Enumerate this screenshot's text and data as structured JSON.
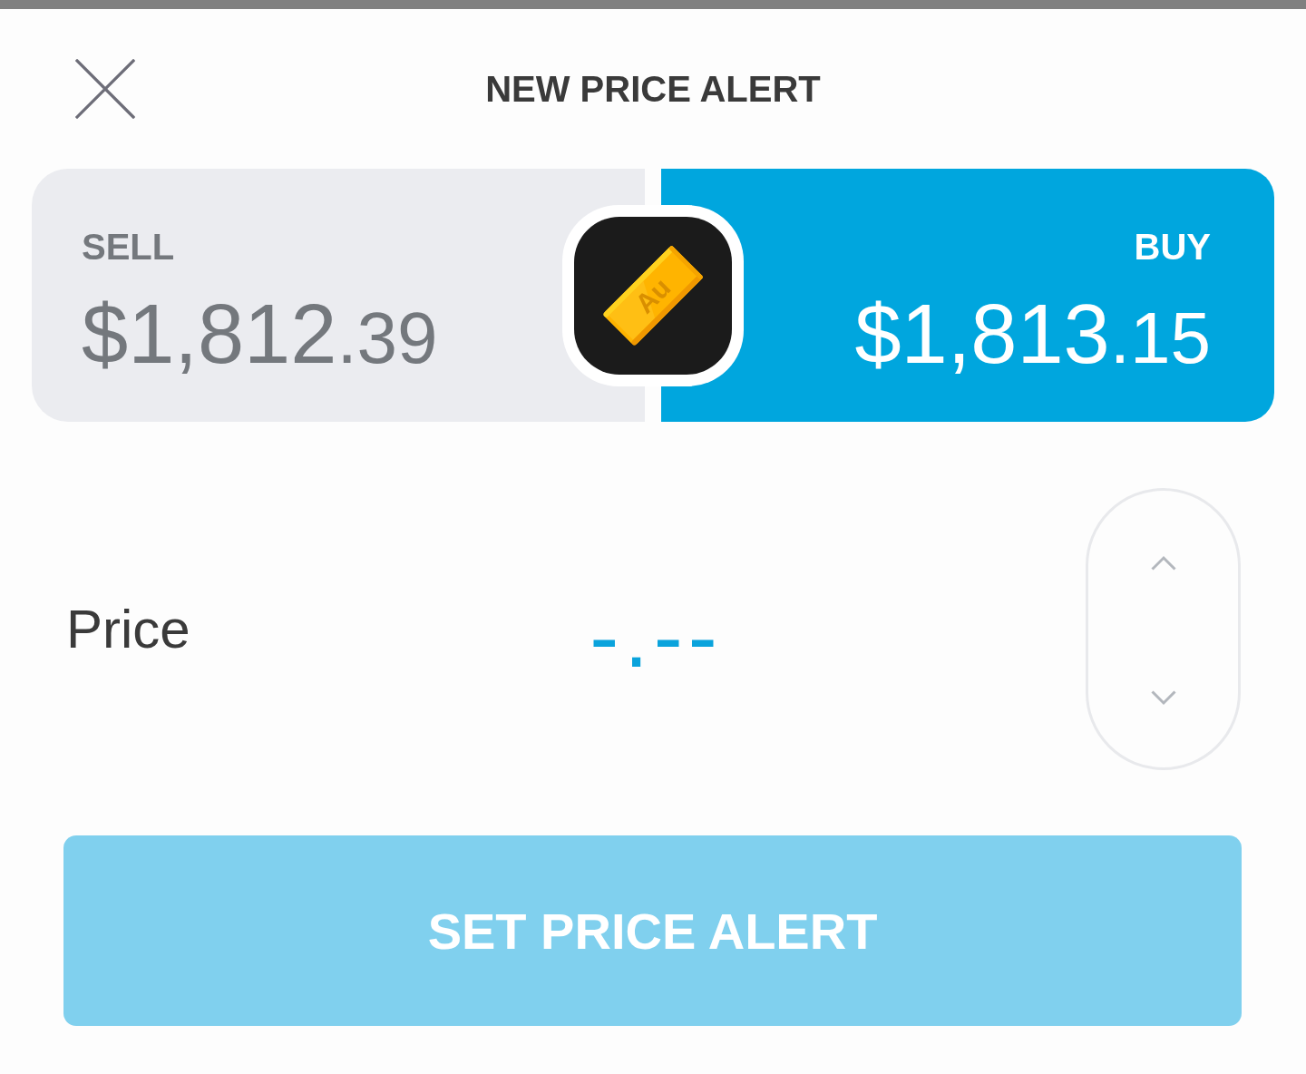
{
  "header": {
    "title": "NEW PRICE ALERT"
  },
  "asset": {
    "symbol": "Au"
  },
  "quotes": [
    {
      "label": "SELL",
      "whole": "$1,812",
      "cents": ".39",
      "selected": false
    },
    {
      "label": "BUY",
      "whole": "$1,813",
      "cents": ".15",
      "selected": true
    }
  ],
  "price_field": {
    "label": "Price",
    "placeholder": "-.--"
  },
  "submit_button": {
    "label": "SET PRICE ALERT",
    "disabled": true
  }
}
